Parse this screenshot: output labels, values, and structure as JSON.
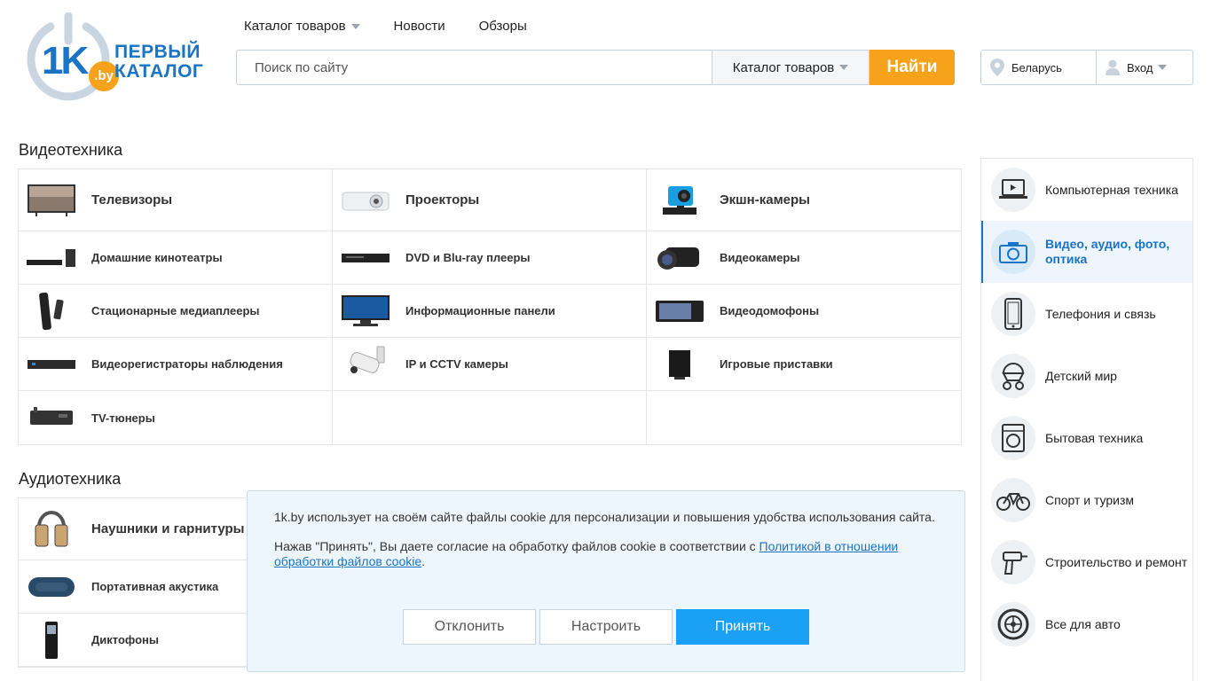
{
  "logo": {
    "main": "1K",
    "by": ".by",
    "line1": "ПЕРВЫЙ",
    "line2": "КАТАЛОГ"
  },
  "nav": {
    "catalog": "Каталог товаров",
    "news": "Новости",
    "reviews": "Обзоры"
  },
  "search": {
    "placeholder": "Поиск по сайту",
    "category": "Каталог товаров",
    "button": "Найти"
  },
  "user": {
    "region": "Беларусь",
    "login": "Вход"
  },
  "colors": {
    "brand": "#1a74c5",
    "accent": "#f7a21b",
    "primary_button": "#1aa0f5"
  },
  "video": {
    "title": "Видеотехника",
    "items": [
      {
        "label": "Телевизоры",
        "icon": "tv-icon"
      },
      {
        "label": "Проекторы",
        "icon": "projector-icon"
      },
      {
        "label": "Экшн-камеры",
        "icon": "action-camera-icon"
      },
      {
        "label": "Домашние кинотеатры",
        "icon": "home-theater-icon"
      },
      {
        "label": "DVD и Blu-ray плееры",
        "icon": "dvd-player-icon"
      },
      {
        "label": "Видеокамеры",
        "icon": "camcorder-icon"
      },
      {
        "label": "Стационарные медиаплееры",
        "icon": "media-player-icon"
      },
      {
        "label": "Информационные панели",
        "icon": "info-panel-icon"
      },
      {
        "label": "Видеодомофоны",
        "icon": "video-intercom-icon"
      },
      {
        "label": "Видеорегистраторы наблюдения",
        "icon": "dvr-icon"
      },
      {
        "label": "IP и CCTV камеры",
        "icon": "cctv-camera-icon"
      },
      {
        "label": "Игровые приставки",
        "icon": "game-console-icon"
      },
      {
        "label": "TV-тюнеры",
        "icon": "tv-tuner-icon"
      }
    ]
  },
  "audio": {
    "title": "Аудиотехника",
    "items": [
      {
        "label": "Наушники и гарнитуры",
        "icon": "headphones-icon"
      },
      {
        "label": "Портативная акустика",
        "icon": "portable-speaker-icon"
      },
      {
        "label": "Диктофоны",
        "icon": "voice-recorder-icon"
      }
    ]
  },
  "sidebar": {
    "items": [
      {
        "label": "Компьютерная техника",
        "icon": "laptop-icon"
      },
      {
        "label": "Видео, аудио, фото, оптика",
        "icon": "camera-icon"
      },
      {
        "label": "Телефония и связь",
        "icon": "phone-icon"
      },
      {
        "label": "Детский мир",
        "icon": "stroller-icon"
      },
      {
        "label": "Бытовая техника",
        "icon": "washing-machine-icon"
      },
      {
        "label": "Спорт и туризм",
        "icon": "bicycle-icon"
      },
      {
        "label": "Строительство и ремонт",
        "icon": "drill-icon"
      },
      {
        "label": "Все для авто",
        "icon": "wheel-icon"
      }
    ]
  },
  "cookie": {
    "text1": "1k.by использует на своём сайте файлы cookie для персонализации и повышения удобства использования сайта.",
    "text2_prefix": "Нажав \"Принять\", Вы даете согласие на обработку файлов cookie в соответствии с ",
    "link": "Политикой в отношении обработки файлов cookie",
    "text2_suffix": ".",
    "reject": "Отклонить",
    "configure": "Настроить",
    "accept": "Принять"
  }
}
